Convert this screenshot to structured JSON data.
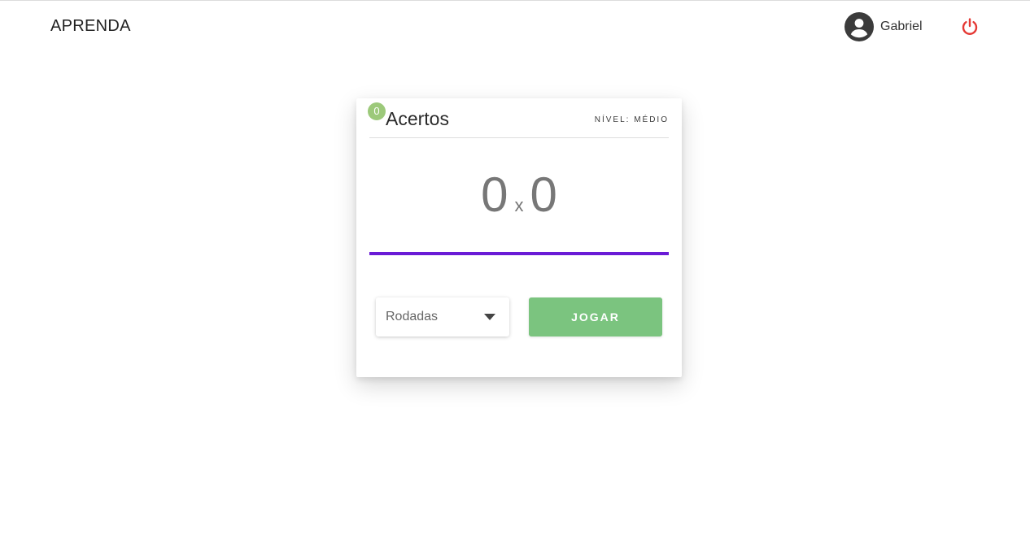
{
  "app": {
    "brand": "APRENDA",
    "user_name": "Gabriel",
    "avatar_icon": "account-circle-icon",
    "logout_icon": "power-icon"
  },
  "card": {
    "score_badge": "0",
    "title": "Acertos",
    "level": "NÍVEL: MÉDIO",
    "score_left": "0",
    "score_separator": "x",
    "score_right": "0",
    "progress_fraction": 1.0,
    "rounds_placeholder": "Rodadas",
    "play_label": "JOGAR"
  },
  "colors": {
    "accent": "#6a1bd6",
    "play_button": "#7bc47f",
    "badge": "#9cc97a",
    "logout": "#e53935"
  }
}
